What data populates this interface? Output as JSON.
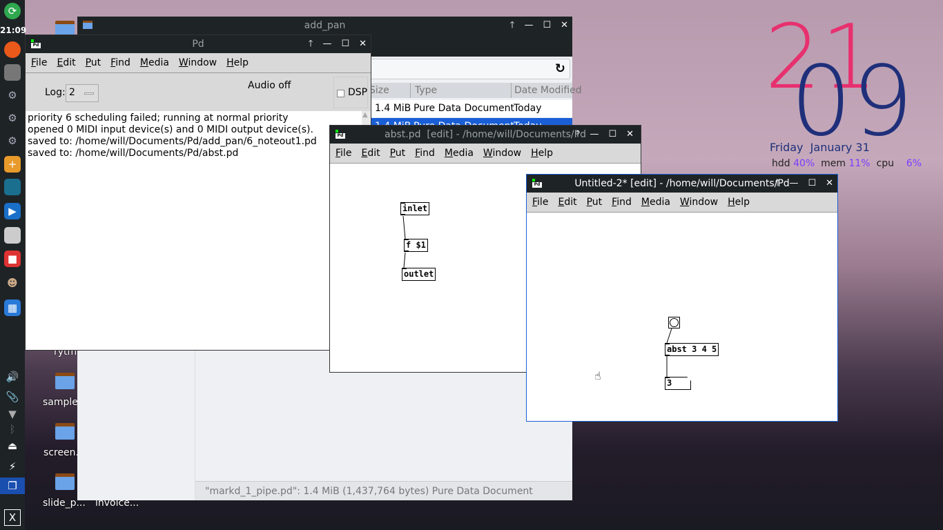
{
  "dock": {
    "clock": "21:09",
    "icons": [
      "session-icon",
      "firefox-icon",
      "files-icon",
      "settings-icon",
      "settings-icon",
      "settings-icon",
      "software-install-icon",
      "book-icon",
      "screen-share-icon",
      "image-viewer-icon",
      "video-icon",
      "gimp-icon",
      "calculator-icon"
    ],
    "tray": [
      "volume-icon",
      "paperclip-icon",
      "wifi-icon",
      "bluetooth-icon",
      "eject-icon",
      "battery-icon",
      "windows-icon",
      "x-icon"
    ]
  },
  "desktop": {
    "icons": [
      {
        "label": ""
      },
      {
        "label": "rytm"
      },
      {
        "label": "sample"
      },
      {
        "label": "screen."
      },
      {
        "label": "slide_p..."
      },
      {
        "label": "invoice..."
      }
    ]
  },
  "file_manager": {
    "title": "add_pan",
    "columns": [
      "Size",
      "Type",
      "Date Modified"
    ],
    "rows": [
      {
        "size": "1.4 MiB",
        "type": "Pure Data Document",
        "date": "Today"
      },
      {
        "size": "1.4 MiB",
        "type": "Pure Data Document",
        "date": "Today",
        "selected": true
      }
    ],
    "status": "\"markd_1_pipe.pd\": 1.4 MiB (1,437,764 bytes) Pure Data Document",
    "accent": "#1a5fd6"
  },
  "menu": [
    "File",
    "Edit",
    "Put",
    "Find",
    "Media",
    "Window",
    "Help"
  ],
  "pd_main": {
    "title": "Pd",
    "log_label": "Log:",
    "log_value": "2",
    "audio_status": "Audio off",
    "dsp_label": "DSP",
    "dsp_checked": false,
    "console": [
      "priority 6 scheduling failed; running at normal priority",
      "opened 0 MIDI input device(s) and 0 MIDI output device(s).",
      "saved to: /home/will/Documents/Pd/add_pan/6_noteout1.pd",
      "saved to: /home/will/Documents/Pd/abst.pd"
    ]
  },
  "abst_window": {
    "title": "abst.pd  [edit] - /home/will/Documents/Pd",
    "objects": [
      "inlet",
      "f $1",
      "outlet"
    ]
  },
  "untitled_window": {
    "title": "Untitled-2* [edit] - /home/will/Documents/Pd",
    "object": "abst 3 4 5",
    "number": "3"
  },
  "conky": {
    "hour": "21",
    "minute": "09",
    "date": "Friday  January 31",
    "hdd_label": "hdd",
    "hdd": "40%",
    "mem_label": "mem",
    "mem": "11%",
    "cpu_label": "cpu",
    "cpu": "6%",
    "colors": {
      "hour": "#e8306e",
      "minute": "#1f2f7a",
      "stats": "#7a3cff"
    }
  }
}
